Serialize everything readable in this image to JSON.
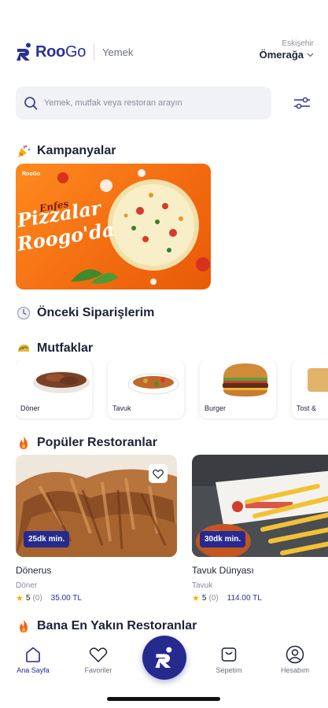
{
  "header": {
    "brand_bold": "Roo",
    "brand_light": "Go",
    "section": "Yemek",
    "city": "Eskişehir",
    "area": "Ömerağa"
  },
  "search": {
    "placeholder": "Yemek, mutfak veya restoran arayın"
  },
  "campaigns": {
    "title": "Kampanyalar",
    "banner": {
      "brand": "RooGo",
      "kicker": "Enfes",
      "line1": "Pizzalar",
      "line2": "Roogo'da"
    }
  },
  "previous_orders": {
    "title": "Önceki Siparişlerim"
  },
  "cuisines": {
    "title": "Mutfaklar",
    "items": [
      {
        "label": "Döner"
      },
      {
        "label": "Tavuk"
      },
      {
        "label": "Burger"
      },
      {
        "label": "Tost &"
      }
    ]
  },
  "popular": {
    "title": "Popüler Restoranlar",
    "items": [
      {
        "time": "25dk min.",
        "name": "Dönerus",
        "category": "Döner",
        "rating": "5",
        "count": "(0)",
        "price": "35.00 TL"
      },
      {
        "time": "30dk min.",
        "name": "Tavuk Dünyası",
        "category": "Tavuk",
        "rating": "5",
        "count": "(0)",
        "price": "114.00 TL"
      }
    ]
  },
  "nearby": {
    "title": "Bana En Yakın Restoranlar"
  },
  "nav": {
    "home": "Ana Sayfa",
    "favorites": "Favoriler",
    "cart": "Sepetim",
    "account": "Hesabım"
  },
  "colors": {
    "brand": "#262a8f",
    "accent_orange": "#f26a10",
    "star": "#f5b301"
  }
}
